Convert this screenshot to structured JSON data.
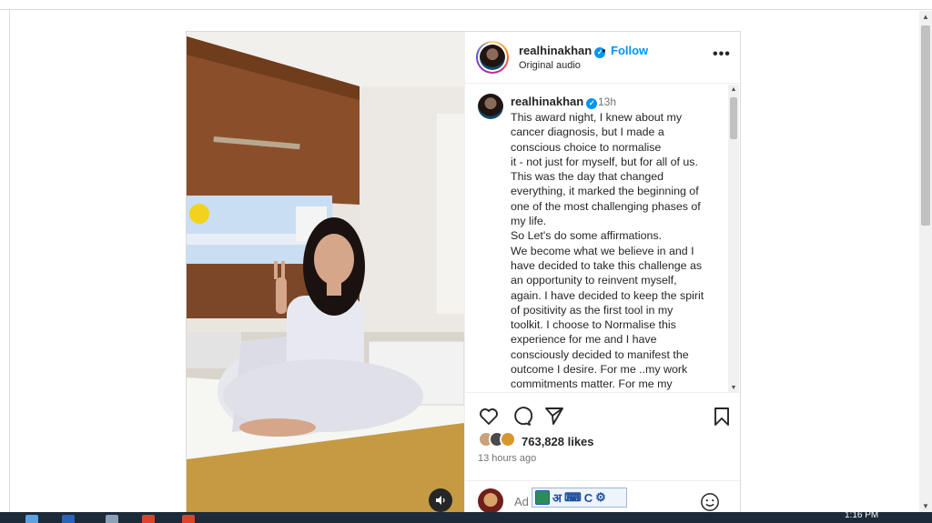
{
  "post": {
    "username": "realhinakhan",
    "follow_label": "Follow",
    "separator": "•",
    "audio": "Original audio",
    "more_label": "•••"
  },
  "caption": {
    "username": "realhinakhan",
    "time": "13h",
    "lines": [
      "This award night, I knew about my",
      "cancer diagnosis, but I made a",
      "conscious choice to normalise",
      "it - not just for myself, but for all of us.",
      "This was the day that changed",
      "everything, it marked the beginning of",
      "one of the most challenging phases of",
      "my life.",
      "So Let's do some affirmations.",
      "We become what we believe in and I",
      "have decided to take this challenge as",
      "an opportunity to reinvent myself,",
      "again. I have decided to keep the spirit",
      "of positivity as the first tool in my",
      "toolkit. I choose to Normalise this",
      "experience for me and I have",
      "consciously decided to manifest the",
      "outcome I desire. For me ..my work",
      "commitments matter. For me my"
    ]
  },
  "engagement": {
    "likes": "763,828 likes",
    "time_ago": "13 hours ago"
  },
  "comment": {
    "placeholder": "Ad"
  },
  "ime": {
    "hindi": "अ",
    "keyboard": "⌨",
    "c": "C",
    "gear": "⚙"
  },
  "taskbar": {
    "clock": "1:16 PM"
  },
  "colors": {
    "accent": "#0095f6",
    "text": "#262626",
    "muted": "#737373"
  }
}
